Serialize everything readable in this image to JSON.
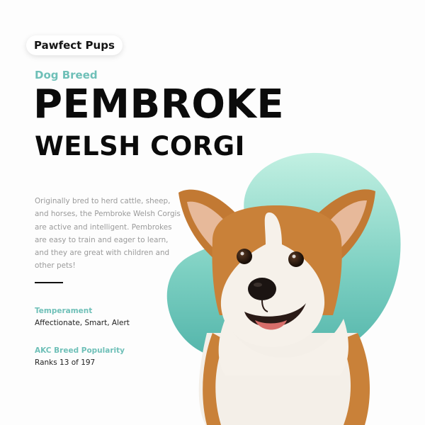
{
  "brand": {
    "name": "Pawfect Pups"
  },
  "hero": {
    "eyebrow": "Dog Breed",
    "title_line1": "PEMBROKE",
    "title_line2": "WELSH CORGI",
    "description": "Originally bred to herd cattle, sheep, and horses, the Pembroke Welsh Corgis are active and intelligent. Pembrokes are easy to train and eager to learn, and they are great with children and other pets!"
  },
  "facts": [
    {
      "label": "Temperament",
      "value": "Affectionate, Smart, Alert"
    },
    {
      "label": "AKC Breed Popularity",
      "value": "Ranks 13 of 197"
    }
  ],
  "colors": {
    "accent": "#6fc0b8",
    "blob_light": "#b6ebdc",
    "blob_dark": "#58b9ae",
    "fur_orange": "#c9813c",
    "fur_white": "#f6f1ea"
  },
  "image": {
    "subject": "pembroke-welsh-corgi-photo"
  }
}
